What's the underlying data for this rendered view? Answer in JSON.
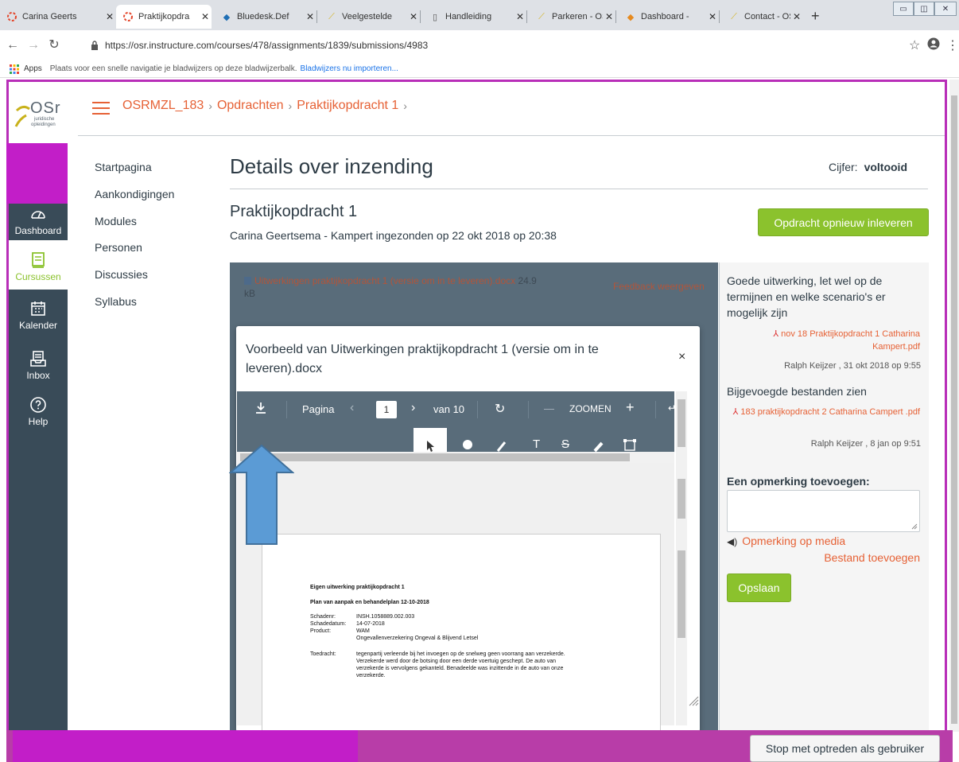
{
  "browser": {
    "tabs": [
      {
        "title": "Carina Geerts",
        "active": false
      },
      {
        "title": "Praktijkopdra",
        "active": true
      },
      {
        "title": "Bluedesk.Def",
        "active": false
      },
      {
        "title": "Veelgestelde",
        "active": false
      },
      {
        "title": "Handleiding",
        "active": false
      },
      {
        "title": "Parkeren - OS",
        "active": false
      },
      {
        "title": "Dashboard -",
        "active": false
      },
      {
        "title": "Contact - OSR",
        "active": false
      }
    ],
    "new_tab": "+",
    "url": "https://osr.instructure.com/courses/478/assignments/1839/submissions/4983",
    "bookmarks": {
      "apps_label": "Apps",
      "hint": "Plaats voor een snelle navigatie je bladwijzers op deze bladwijzerbalk.",
      "import_link": "Bladwijzers nu importeren..."
    }
  },
  "logo": {
    "letters": "OSr",
    "sub1": "juridische",
    "sub2": "opleidingen"
  },
  "global_nav": [
    {
      "label": "Dashboard",
      "icon": "dashboard-icon"
    },
    {
      "label": "Cursussen",
      "icon": "courses-icon"
    },
    {
      "label": "Kalender",
      "icon": "calendar-icon"
    },
    {
      "label": "Inbox",
      "icon": "inbox-icon"
    },
    {
      "label": "Help",
      "icon": "help-icon"
    }
  ],
  "breadcrumbs": [
    "OSRMZL_183",
    "Opdrachten",
    "Praktijkopdracht 1"
  ],
  "breadcrumb_sep": "›",
  "course_nav": [
    "Startpagina",
    "Aankondigingen",
    "Modules",
    "Personen",
    "Discussies",
    "Syllabus"
  ],
  "main": {
    "title": "Details over inzending",
    "grade_label": "Cijfer:",
    "grade_value": "voltooid",
    "assignment": "Praktijkopdracht 1",
    "submitted": "Carina Geertsema - Kampert ingezonden op 22 okt 2018 op 20:38",
    "resubmit": "Opdracht opnieuw inleveren"
  },
  "preview": {
    "file_name": "Uitwerkingen praktijkopdracht 1 (versie om in te leveren).docx",
    "file_size": "24.9 kB",
    "feedback_link": "Feedback weergeven"
  },
  "modal": {
    "title": "Voorbeeld van Uitwerkingen praktijkopdracht 1 (versie om in te leveren).docx",
    "close": "×",
    "page_label": "Pagina",
    "page_value": "1",
    "page_total": "van 10",
    "zoom_label": "ZOOMEN",
    "zoom_minus": "—",
    "zoom_plus": "+"
  },
  "document": {
    "heading": "Eigen uitwerking praktijkopdracht 1",
    "subheading": "Plan van aanpak en behandelplan 12-10-2018",
    "rows": [
      {
        "k": "Schadenr:",
        "v": "INSH.1058889.002.003"
      },
      {
        "k": "Schadedatum:",
        "v": "14-07-2018"
      },
      {
        "k": "Product:",
        "v": "WAM"
      },
      {
        "k": "",
        "v": "Ongevallenverzekering Ongeval & Blijvend Letsel"
      }
    ],
    "toedracht_label": "Toedracht:",
    "toedracht": [
      "tegenpartij verleende bij het invoegen op de snelweg geen voorrang aan verzekerde.",
      "Verzekerde werd door de botsing door een derde voertuig geschept. De auto van",
      "verzekerde is vervolgens gekanteld. Benadeelde was inzittende in de auto van onze",
      "verzekerde."
    ]
  },
  "sidebar": {
    "comment1": "Goede uitwerking, let wel op de termijnen en welke scenario's er mogelijk zijn",
    "file1": "nov 18 Praktijkopdracht 1 Catharina Kampert.pdf",
    "author1": "Ralph Keijzer , 31 okt 2018 op 9:55",
    "comment2": "Bijgevoegde bestanden zien",
    "file2": "183 praktijkopdracht 2 Catharina Campert .pdf",
    "author2": "Ralph Keijzer , 8 jan op 9:51",
    "add_comment": "Een opmerking toevoegen:",
    "media_link": "Opmerking op media",
    "attach_link": "Bestand toevoegen",
    "save": "Opslaan"
  },
  "stop_acting": "Stop met optreden als gebruiker",
  "colors": {
    "accent": "#e66135",
    "nav": "#394b58",
    "green": "#8bc22d",
    "overlay": "#c21ec8",
    "arrow": "#5b9bd5"
  }
}
